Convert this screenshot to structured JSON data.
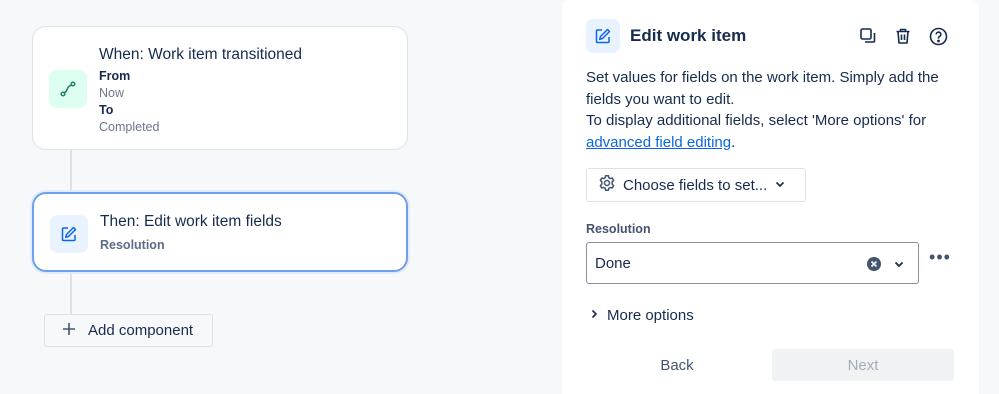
{
  "workflow": {
    "trigger": {
      "title": "When: Work item transitioned",
      "from_label": "From",
      "from_value": "Now",
      "to_label": "To",
      "to_value": "Completed",
      "icon": "transition-icon"
    },
    "action": {
      "title": "Then: Edit work item fields",
      "subtitle": "Resolution",
      "icon": "edit-icon"
    },
    "add_component_label": "Add component"
  },
  "panel": {
    "title": "Edit work item",
    "icons": [
      "duplicate-icon",
      "delete-icon",
      "help-icon"
    ],
    "description_line1": "Set values for fields on the work item. Simply add the fields you want to edit.",
    "description_line2": "To display additional fields, select 'More options' for",
    "description_link": "advanced field editing",
    "description_end": ".",
    "choose_fields_label": "Choose fields to set...",
    "resolution_label": "Resolution",
    "resolution_value": "Done",
    "more_options_label": "More options",
    "back_label": "Back",
    "next_label": "Next"
  },
  "colors": {
    "accent": "#0c66e4",
    "selected_border": "#6f9ff0",
    "trigger_tile": "#dcfff1",
    "action_tile": "#e9f2ff"
  }
}
